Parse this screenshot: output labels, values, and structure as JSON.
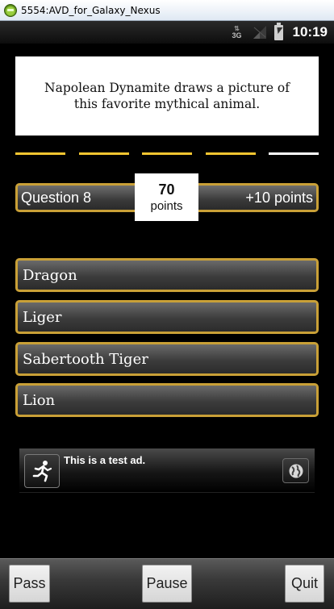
{
  "window": {
    "title": "5554:AVD_for_Galaxy_Nexus"
  },
  "status_bar": {
    "network": "3G",
    "time": "10:19"
  },
  "question": {
    "text": "Napolean Dynamite draws a picture of this favorite mythical animal."
  },
  "progress": {
    "total_segments": 5,
    "segments_done": 4,
    "done_color": "#f5c531",
    "pending_color": "#ffffff"
  },
  "score": {
    "question_label": "Question 8",
    "points_value": "70",
    "points_label": "points",
    "reward_label": "+10 points"
  },
  "answers": [
    {
      "label": "Dragon"
    },
    {
      "label": "Liger"
    },
    {
      "label": "Sabertooth Tiger"
    },
    {
      "label": "Lion"
    }
  ],
  "ad": {
    "text": "This is a test ad.",
    "left_icon": "running-man-icon",
    "right_icon": "globe-icon"
  },
  "bottom_bar": {
    "pass_label": "Pass",
    "pause_label": "Pause",
    "quit_label": "Quit"
  },
  "colors": {
    "accent_border": "#c9a037"
  }
}
